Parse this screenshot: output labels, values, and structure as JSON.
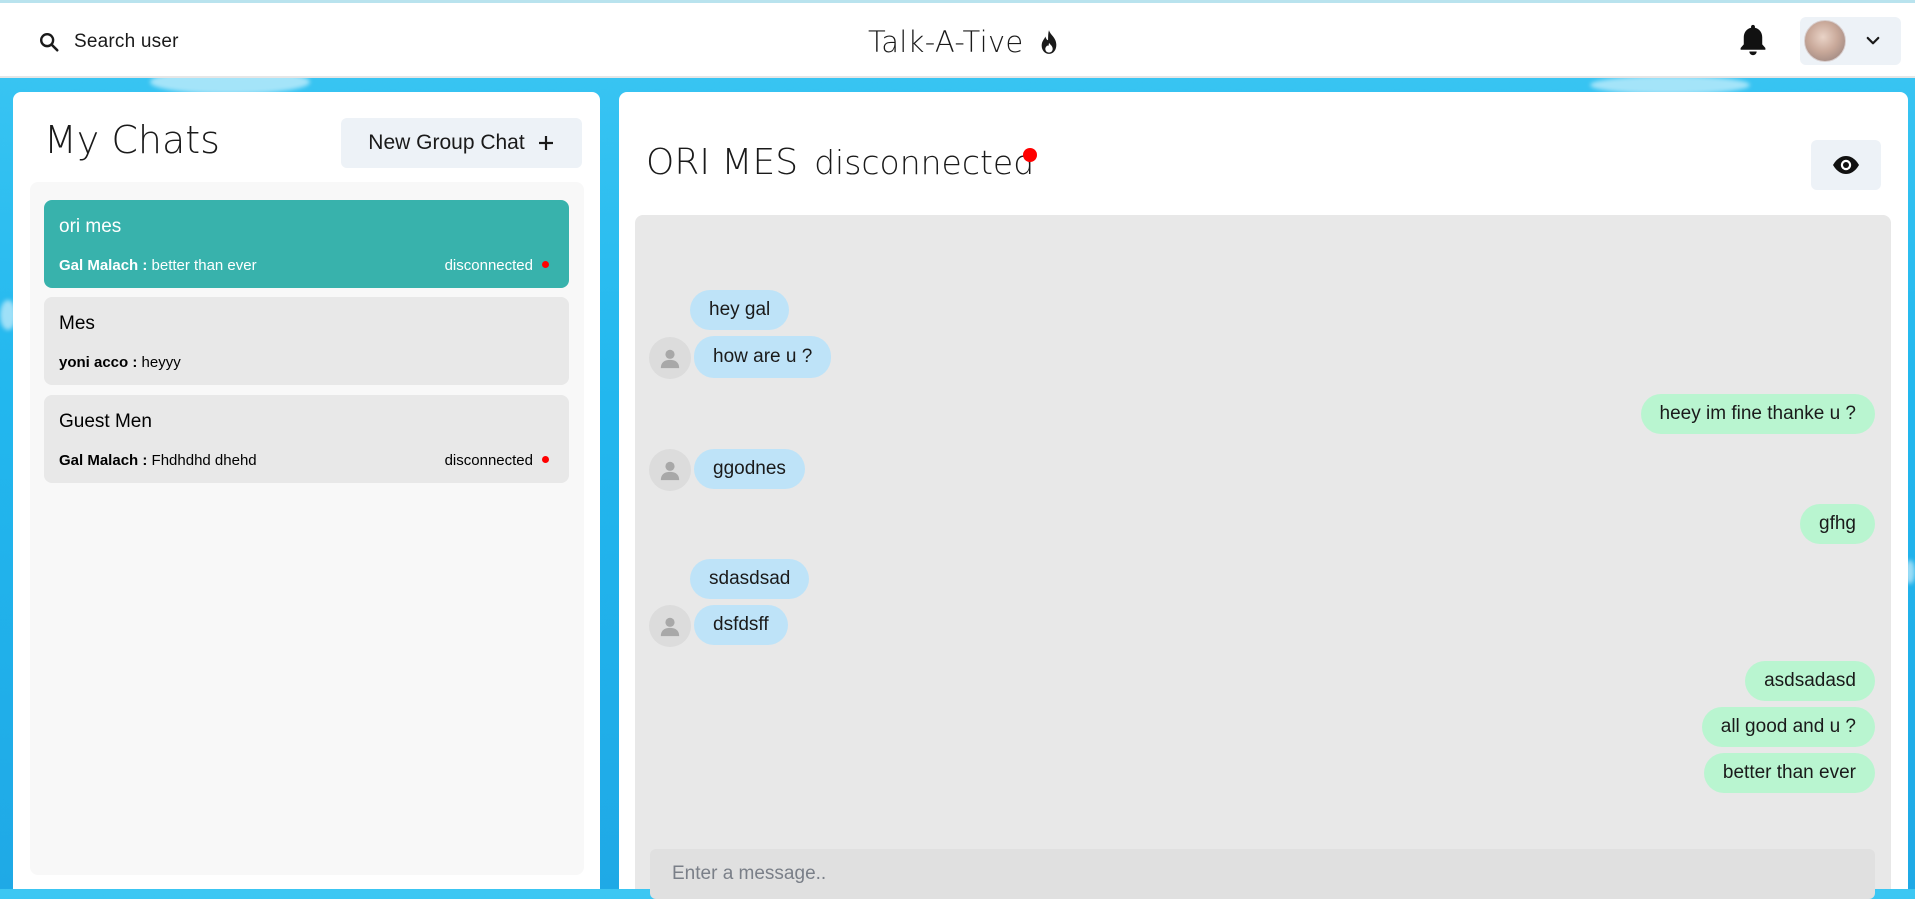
{
  "header": {
    "search_label": "Search user",
    "app_title": "Talk-A-Tive",
    "icons": {
      "search": "search-icon",
      "logo": "flame-icon",
      "bell": "bell-icon",
      "chevron": "chevron-down-icon"
    }
  },
  "sidebar": {
    "title": "My Chats",
    "new_group_label": "New Group Chat",
    "chats": [
      {
        "name": "ori mes",
        "sender": "Gal Malach :",
        "message": "better than ever",
        "status": "disconnected",
        "active": true
      },
      {
        "name": "Mes",
        "sender": "yoni acco :",
        "message": "heyyy",
        "status": "",
        "active": false
      },
      {
        "name": "Guest Men",
        "sender": "Gal Malach :",
        "message": "Fhdhdhd dhehd",
        "status": "disconnected",
        "active": false
      }
    ]
  },
  "chat": {
    "name": "ORI MES",
    "status": "disconnected",
    "messages": [
      {
        "text": "hey gal",
        "from": "other"
      },
      {
        "text": "how are u ?",
        "from": "other"
      },
      {
        "text": "heey im fine thanke u ?",
        "from": "me"
      },
      {
        "text": "ggodnes",
        "from": "other"
      },
      {
        "text": "gfhg",
        "from": "me"
      },
      {
        "text": "sdasdsad",
        "from": "other"
      },
      {
        "text": "dsfdsff",
        "from": "other"
      },
      {
        "text": "asdsadasd",
        "from": "me"
      },
      {
        "text": "all good and u ?",
        "from": "me"
      },
      {
        "text": "better than ever",
        "from": "me"
      }
    ],
    "input_placeholder": "Enter a message.."
  },
  "colors": {
    "active_chat": "#38b2ac",
    "incoming_bubble": "#bee3f8",
    "outgoing_bubble": "#b9f5d0",
    "status_dot": "#ff0000",
    "background": "#22b7ee"
  }
}
